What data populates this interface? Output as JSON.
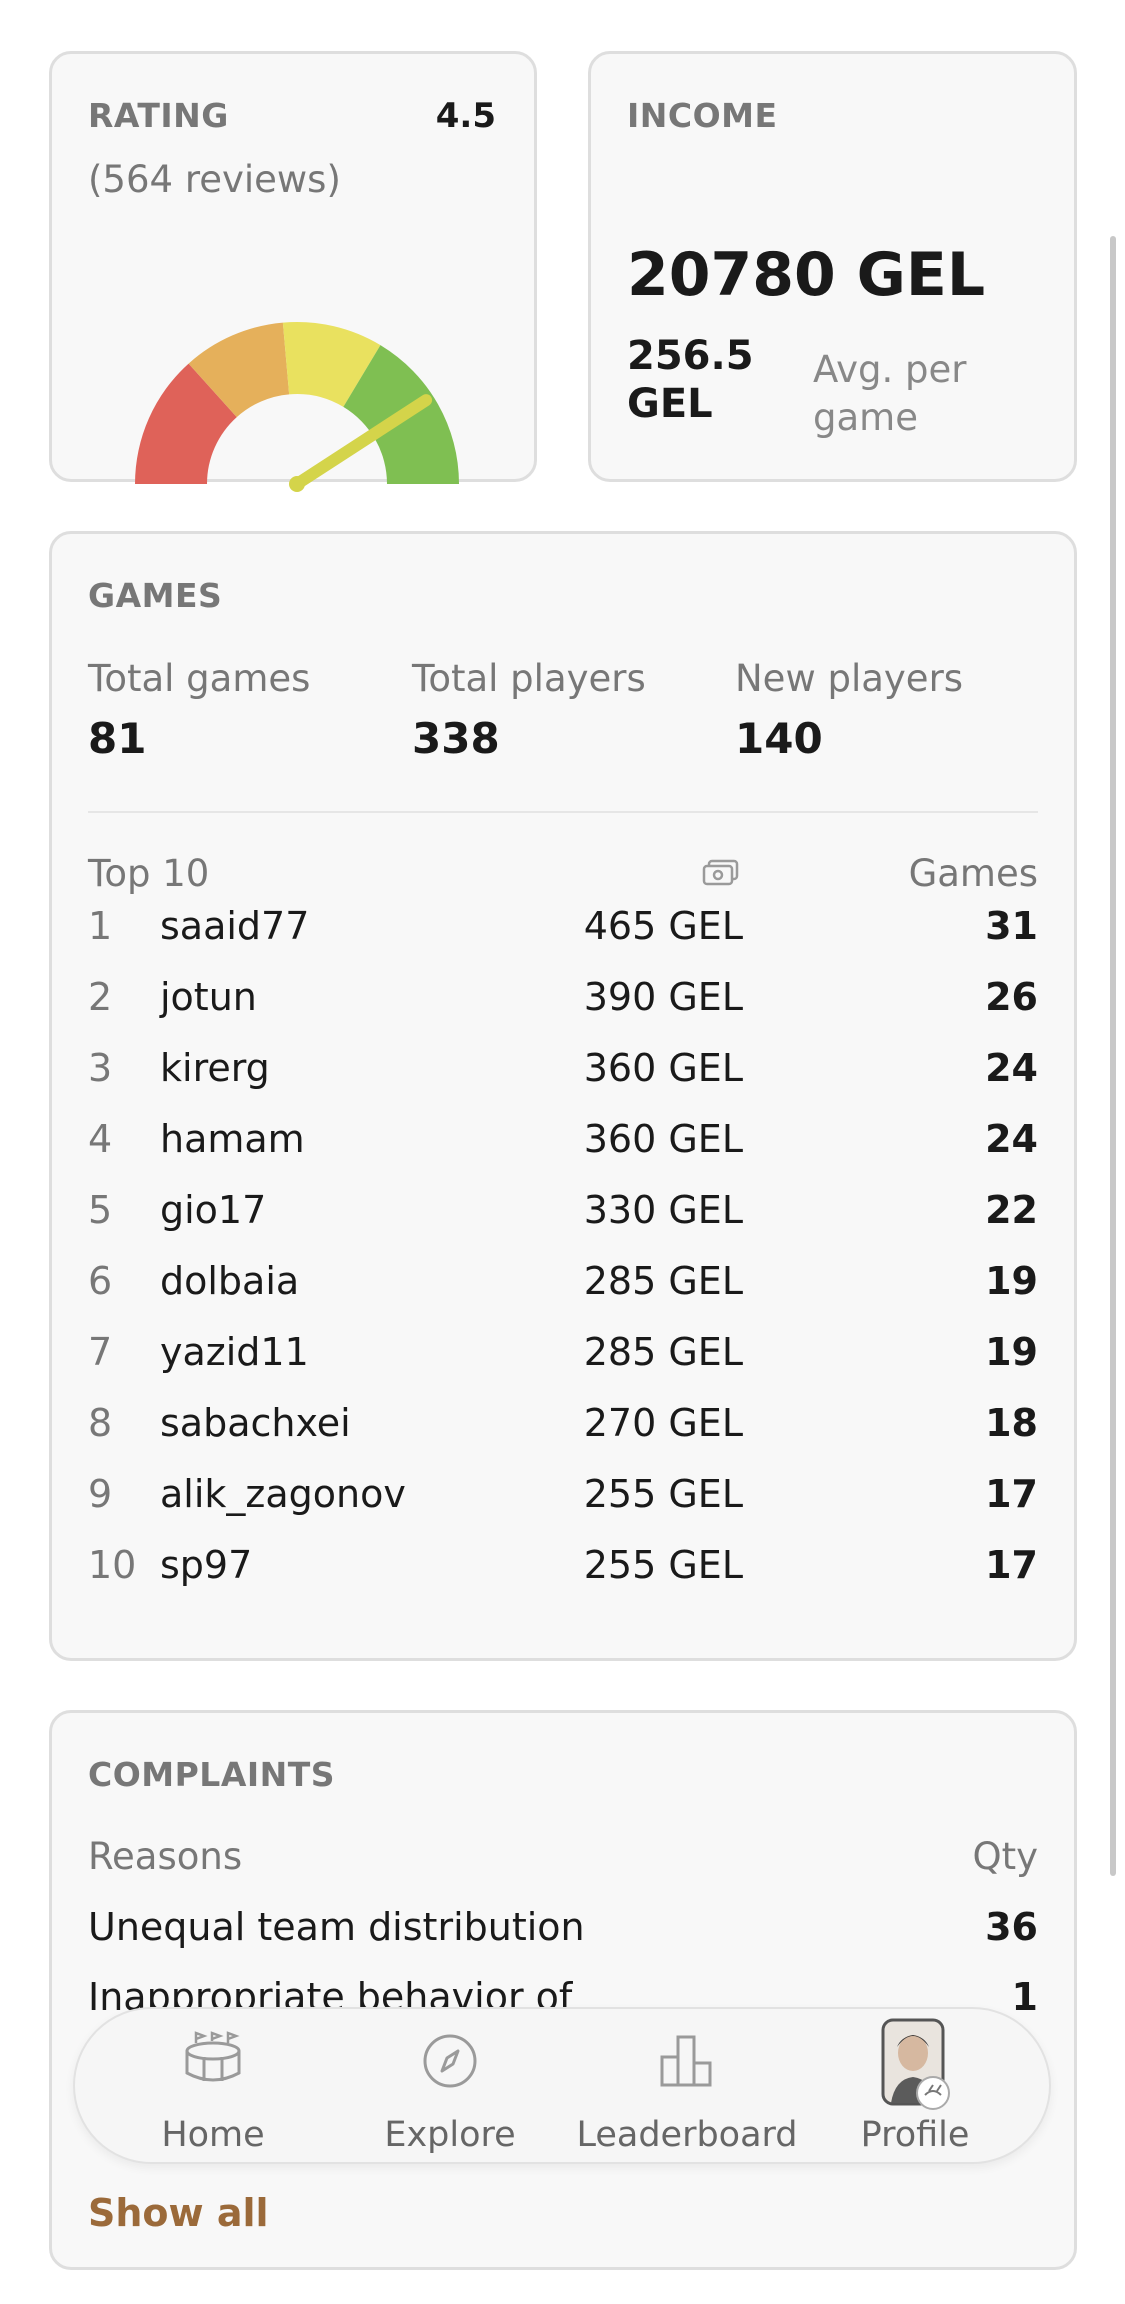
{
  "rating": {
    "title": "RATING",
    "value": "4.5",
    "reviews": "(564 reviews)",
    "gauge": {
      "score": 4.5,
      "max": 5,
      "colors": [
        "#df6259",
        "#e5b05b",
        "#e9e15f",
        "#7fbf52"
      ],
      "needle_color": "#d4d44a"
    }
  },
  "income": {
    "title": "INCOME",
    "total": "20780 GEL",
    "avg_value": "256.5 GEL",
    "avg_label": "Avg. per game"
  },
  "games": {
    "title": "GAMES",
    "stats": [
      {
        "label": "Total games",
        "value": "81"
      },
      {
        "label": "Total players",
        "value": "338"
      },
      {
        "label": "New players",
        "value": "140"
      }
    ],
    "top_header": "Top 10",
    "money_icon": "money-icon",
    "games_header": "Games",
    "top": [
      {
        "rank": "1",
        "name": "saaid77",
        "money": "465 GEL",
        "games": "31"
      },
      {
        "rank": "2",
        "name": "jotun",
        "money": "390 GEL",
        "games": "26"
      },
      {
        "rank": "3",
        "name": "kirerg",
        "money": "360 GEL",
        "games": "24"
      },
      {
        "rank": "4",
        "name": "hamam",
        "money": "360 GEL",
        "games": "24"
      },
      {
        "rank": "5",
        "name": "gio17",
        "money": "330 GEL",
        "games": "22"
      },
      {
        "rank": "6",
        "name": "dolbaia",
        "money": "285 GEL",
        "games": "19"
      },
      {
        "rank": "7",
        "name": "yazid11",
        "money": "285 GEL",
        "games": "19"
      },
      {
        "rank": "8",
        "name": "sabachxei",
        "money": "270 GEL",
        "games": "18"
      },
      {
        "rank": "9",
        "name": "alik_zagonov",
        "money": "255 GEL",
        "games": "17"
      },
      {
        "rank": "10",
        "name": "sp97",
        "money": "255 GEL",
        "games": "17"
      }
    ]
  },
  "complaints": {
    "title": "COMPLAINTS",
    "reasons_header": "Reasons",
    "qty_header": "Qty",
    "items": [
      {
        "reason": "Unequal team distribution",
        "qty": "36"
      },
      {
        "reason": "Inappropriate behavior of",
        "qty": "1"
      }
    ],
    "show_all": "Show all"
  },
  "nav": {
    "items": [
      {
        "label": "Home",
        "icon": "stadium-icon"
      },
      {
        "label": "Explore",
        "icon": "compass-icon"
      },
      {
        "label": "Leaderboard",
        "icon": "podium-icon"
      },
      {
        "label": "Profile",
        "icon": "avatar-icon"
      }
    ]
  }
}
